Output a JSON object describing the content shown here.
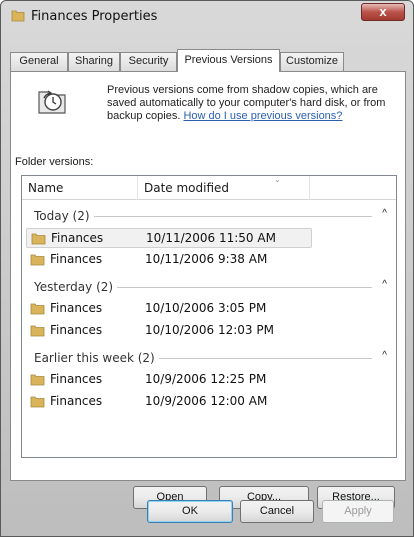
{
  "window": {
    "title": "Finances Properties",
    "close_glyph": "x"
  },
  "tabs": [
    {
      "label": "General"
    },
    {
      "label": "Sharing"
    },
    {
      "label": "Security"
    },
    {
      "label": "Previous Versions",
      "active": true
    },
    {
      "label": "Customize"
    }
  ],
  "info": {
    "text": "Previous versions come from shadow copies, which are saved automatically to your computer's hard disk, or from backup copies.",
    "link": "How do I use previous versions?"
  },
  "folder_versions_label": "Folder versions:",
  "columns": {
    "name": "Name",
    "date": "Date modified"
  },
  "groups": [
    {
      "label": "Today (2)",
      "items": [
        {
          "name": "Finances",
          "date": "10/11/2006 11:50 AM",
          "selected": true
        },
        {
          "name": "Finances",
          "date": "10/11/2006 9:38 AM"
        }
      ]
    },
    {
      "label": "Yesterday (2)",
      "items": [
        {
          "name": "Finances",
          "date": "10/10/2006 3:05 PM"
        },
        {
          "name": "Finances",
          "date": "10/10/2006 12:03 PM"
        }
      ]
    },
    {
      "label": "Earlier this week (2)",
      "items": [
        {
          "name": "Finances",
          "date": "10/9/2006 12:25 PM"
        },
        {
          "name": "Finances",
          "date": "10/9/2006 12:00 AM"
        }
      ]
    }
  ],
  "panel_buttons": {
    "open": "Open",
    "copy": "Copy...",
    "restore": "Restore..."
  },
  "dialog_buttons": {
    "ok": "OK",
    "cancel": "Cancel",
    "apply": "Apply"
  },
  "colors": {
    "link": "#2a5fb0",
    "folder": "#d9b45a",
    "close_button": "#b9544b"
  }
}
